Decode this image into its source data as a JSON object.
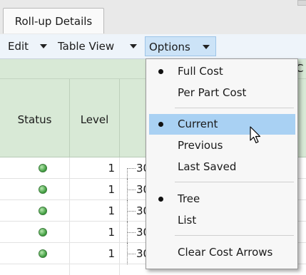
{
  "tab": {
    "label": "Roll-up Details"
  },
  "menubar": [
    {
      "label": "Edit",
      "active": false
    },
    {
      "label": "Table View",
      "active": false
    },
    {
      "label": "Options",
      "active": true
    }
  ],
  "grid": {
    "header_partial": "C",
    "columns": [
      "Status",
      "Level"
    ],
    "rows": [
      {
        "level": "1",
        "tree_text": "30"
      },
      {
        "level": "1",
        "tree_text": "30"
      },
      {
        "level": "1",
        "tree_text": "30"
      },
      {
        "level": "1",
        "tree_text": "30"
      },
      {
        "level": "1",
        "tree_text": "30"
      }
    ]
  },
  "options_menu": {
    "groups": [
      [
        {
          "label": "Full Cost",
          "checked": true
        },
        {
          "label": "Per Part Cost",
          "checked": false
        }
      ],
      [
        {
          "label": "Current",
          "checked": true
        },
        {
          "label": "Previous",
          "checked": false
        },
        {
          "label": "Last Saved",
          "checked": false
        }
      ],
      [
        {
          "label": "Tree",
          "checked": true
        },
        {
          "label": "List",
          "checked": false
        }
      ],
      [
        {
          "label": "Clear Cost Arrows",
          "checked": false
        }
      ]
    ],
    "highlighted": "Current"
  },
  "colors": {
    "header_green": "#d8e9d6",
    "menu_highlight": "#a9d1f3",
    "status_green": "#3a9a3a"
  }
}
